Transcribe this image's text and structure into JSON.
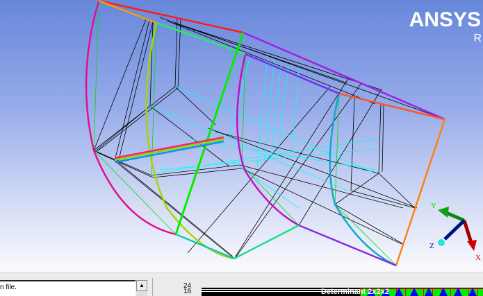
{
  "viewport": {
    "brand": "ANSYS",
    "brand_sub": "R",
    "triad": {
      "x": "X",
      "y": "Y",
      "z": "Z"
    }
  },
  "messages": {
    "line1": "n file."
  },
  "scrollbar": {
    "up_arrow": "▲"
  },
  "mesh_metric": {
    "tick_top": "24",
    "tick_bottom": "18",
    "label": "Determinant 2x2x2"
  },
  "colors": {
    "background_top": "#6787da",
    "accent_magenta": "#e0108f",
    "accent_purple": "#8a2be2"
  }
}
